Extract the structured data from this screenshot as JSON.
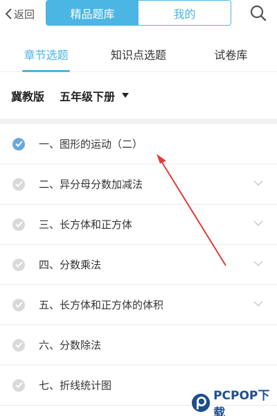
{
  "header": {
    "back_label": "返回",
    "segments": [
      "精品题库",
      "我的"
    ],
    "active_segment": 0
  },
  "tabs": [
    "章节选题",
    "知识点选题",
    "试卷库"
  ],
  "filter": {
    "edition": "冀教版",
    "grade": "五年级下册"
  },
  "chapters": [
    {
      "label": "一、图形的运动（二）",
      "completed": true,
      "expandable": false
    },
    {
      "label": "二、异分母分数加减法",
      "completed": false,
      "expandable": true
    },
    {
      "label": "三、长方体和正方体",
      "completed": false,
      "expandable": true
    },
    {
      "label": "四、分数乘法",
      "completed": false,
      "expandable": true
    },
    {
      "label": "五、长方体和正方体的体积",
      "completed": false,
      "expandable": true
    },
    {
      "label": "六、分数除法",
      "completed": false,
      "expandable": false
    },
    {
      "label": "七、折线统计图",
      "completed": false,
      "expandable": false
    }
  ],
  "watermark": {
    "text": "PCPOP下载"
  },
  "colors": {
    "accent": "#4bb5e3",
    "check_done": "#6aa9d9",
    "check_pending": "#d9d9d9",
    "annotation_arrow": "#e23b3b"
  }
}
